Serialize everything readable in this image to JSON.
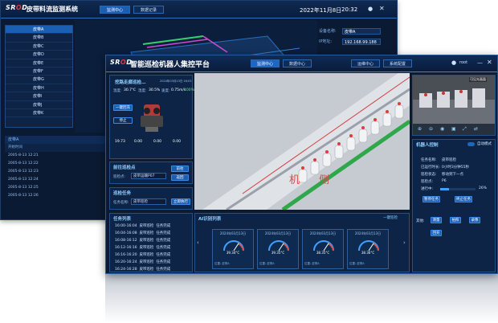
{
  "back": {
    "logo": {
      "a": "SR",
      "o": "O",
      "b": "D"
    },
    "title": "皮带料流监测系统",
    "tabs": [
      "监测中心",
      "数据记录"
    ],
    "datetime": "2022年11月8日",
    "time": "20:32",
    "sidebar": [
      "皮带A",
      "皮带B",
      "皮带C",
      "皮带D",
      "皮带E",
      "皮带F",
      "皮带G",
      "皮带H",
      "皮带I",
      "皮带J",
      "皮带K"
    ],
    "info": [
      {
        "k": "设备名称:",
        "v": "皮带A"
      },
      {
        "k": "IP地址:",
        "v": "192.168.99.188"
      }
    ],
    "table_head": "皮带A",
    "table_sub": "开始时间",
    "table_rows": [
      "2005-8-13 12:21",
      "2005-8-13 12:22",
      "2005-8-13 12:23",
      "2005-8-13 12:24",
      "2005-8-13 12:25",
      "2005-8-13 12:26"
    ]
  },
  "front": {
    "logo": {
      "a": "SR",
      "o": "O",
      "b": "D"
    },
    "title": "智能巡检机器人集控平台",
    "nav": [
      "监测中心",
      "数据中心",
      "运维中心",
      "系统配置"
    ],
    "user": "root",
    "robot": {
      "name": "挖路走廊巡检…",
      "time": "2024年03月13日 16:03",
      "temp_label": "温度:",
      "temp": "30.7℃",
      "hum_label": "湿度:",
      "hum": "30.5%",
      "speed_label": "速度:",
      "speed": "0.75m/s",
      "battery": "100%"
    },
    "actions": [
      "一键回充",
      "停止"
    ],
    "readouts": [
      "19.73",
      "0.00",
      "0.00",
      "0.00"
    ],
    "point_panel": {
      "title": "前往巡检点",
      "label": "巡检点:",
      "value": "皮带运输P07",
      "buttons": [
        "前往",
        "返回"
      ]
    },
    "task_panel": {
      "title": "巡检任务",
      "label": "任务名称:",
      "value": "皮带巡检",
      "button": "立即执行"
    },
    "task_list": {
      "title": "任务列表",
      "rows": [
        {
          "time": "16:00-16:04",
          "name": "皮带巡检",
          "state": "任务完成"
        },
        {
          "time": "16:04-16:08",
          "name": "皮带巡检",
          "state": "任务完成"
        },
        {
          "time": "16:08-16:12",
          "name": "皮带巡检",
          "state": "任务完成"
        },
        {
          "time": "16:12-16:16",
          "name": "皮带巡检",
          "state": "任务完成"
        },
        {
          "time": "16:16-16:20",
          "name": "皮带巡检",
          "state": "任务完成"
        },
        {
          "time": "16:20-16:24",
          "name": "皮带巡检",
          "state": "任务完成"
        },
        {
          "time": "16:24-16:28",
          "name": "皮带巡检",
          "state": "任务完成"
        }
      ]
    },
    "ai_panel": {
      "title": "AI识别列表",
      "button": "一键巡检",
      "gauges": [
        {
          "title": "2024年03月13日",
          "value": "39.34°C",
          "foot": "位置: 皮带A"
        },
        {
          "title": "2024年03月13日",
          "value": "39.35°C",
          "foot": "位置: 皮带A"
        },
        {
          "title": "2024年03月13日",
          "value": "38.35°C",
          "foot": "位置: 皮带A"
        },
        {
          "title": "2024年03月13日",
          "value": "38.36°C",
          "foot": "位置: 皮带A"
        }
      ]
    },
    "camera": {
      "label": "可见光画面"
    },
    "control": {
      "title": "机器人控制",
      "mode": "自动模式",
      "fields": [
        {
          "k": "任务名称:",
          "v": "皮带巡检"
        },
        {
          "k": "已运行时长:",
          "v": "0小时3分钟55秒"
        },
        {
          "k": "巡检状态:",
          "v": "移动到下一点"
        },
        {
          "k": "巡检点:",
          "v": "P6"
        }
      ],
      "progress_label": "进行中:",
      "progress": 0.26,
      "progress_text": "26%",
      "buttons": [
        "暂停任务",
        "终止任务"
      ],
      "other_label": "其他:",
      "other_buttons": [
        "测量",
        "拍照",
        "录像",
        "回充"
      ]
    },
    "scene_text": "机 侧"
  }
}
